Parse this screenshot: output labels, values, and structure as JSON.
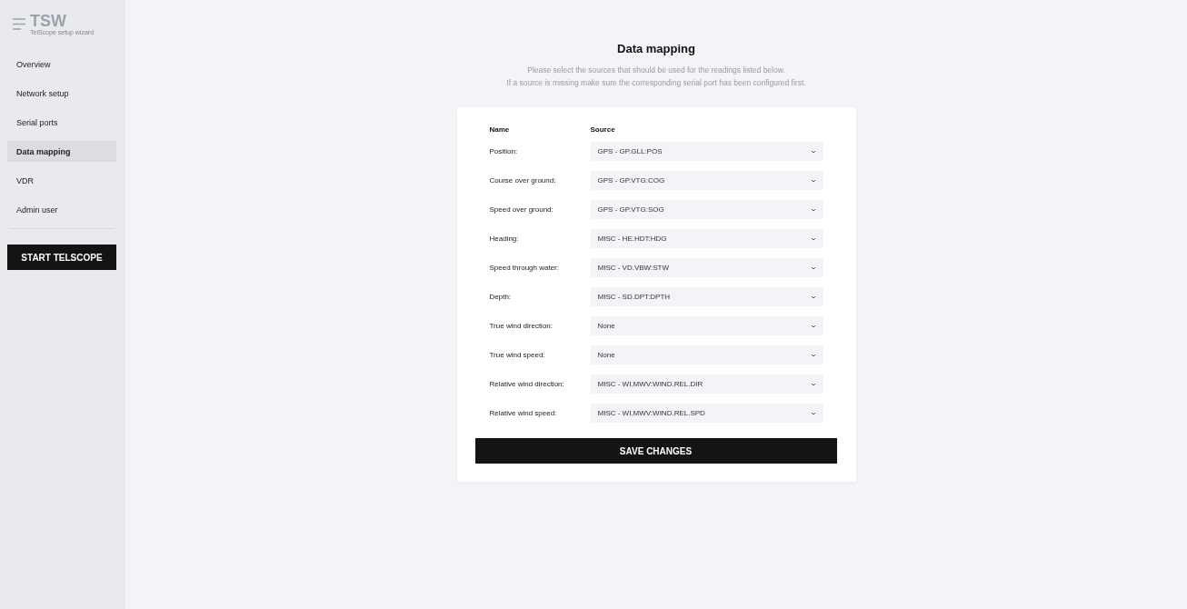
{
  "brand": {
    "name": "TSW",
    "subtitle": "TelScope setup wizard"
  },
  "sidebar": {
    "items": [
      {
        "label": "Overview",
        "selected": false
      },
      {
        "label": "Network setup",
        "selected": false
      },
      {
        "label": "Serial ports",
        "selected": false
      },
      {
        "label": "Data mapping",
        "selected": true
      },
      {
        "label": "VDR",
        "selected": false
      },
      {
        "label": "Admin user",
        "selected": false
      }
    ],
    "start_button": "START TELSCOPE"
  },
  "page": {
    "title": "Data mapping",
    "description": [
      "Please select the sources that should be used for the readings listed below.",
      "If a source is missing make sure the corresponding serial port has been configured first."
    ]
  },
  "table": {
    "columns": [
      "Name",
      "Source"
    ],
    "rows": [
      {
        "name": "Position:",
        "source": "GPS - GP.GLL:POS"
      },
      {
        "name": "Course over ground:",
        "source": "GPS - GP.VTG:COG"
      },
      {
        "name": "Speed over ground:",
        "source": "GPS - GP.VTG:SOG"
      },
      {
        "name": "Heading:",
        "source": "MISC - HE.HDT:HDG"
      },
      {
        "name": "Speed through water:",
        "source": "MISC - VD.VBW:STW"
      },
      {
        "name": "Depth:",
        "source": "MISC - SD.DPT:DPTH"
      },
      {
        "name": "True wind direction:",
        "source": "None"
      },
      {
        "name": "True wind speed:",
        "source": "None"
      },
      {
        "name": "Relative wind direction:",
        "source": "MISC - WI.MWV:WIND.REL.DIR"
      },
      {
        "name": "Relative wind speed:",
        "source": "MISC - WI.MWV:WIND.REL.SPD"
      }
    ]
  },
  "save_button": "SAVE CHANGES"
}
